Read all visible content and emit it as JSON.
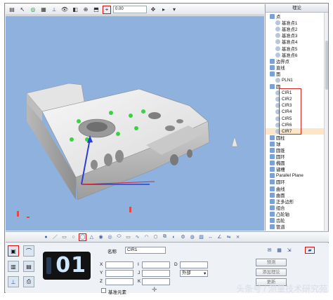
{
  "toolbar": {
    "value_field": "0.00",
    "icons": [
      "select-icon",
      "pointer-icon",
      "target-icon",
      "grid-icon",
      "axis-icon",
      "eye-icon",
      "cube-icon",
      "zoom-icon",
      "probe-icon",
      "crosshair-icon",
      "arrow-icon"
    ]
  },
  "tree": {
    "header": "理论",
    "items": [
      {
        "label": "点",
        "level": 0
      },
      {
        "label": "基准点1",
        "level": 1
      },
      {
        "label": "基准点2",
        "level": 1
      },
      {
        "label": "基准点3",
        "level": 1
      },
      {
        "label": "基准点4",
        "level": 1
      },
      {
        "label": "基准点5",
        "level": 1
      },
      {
        "label": "基准点6",
        "level": 1
      },
      {
        "label": "边界点",
        "level": 0
      },
      {
        "label": "直线",
        "level": 0
      },
      {
        "label": "面",
        "level": 0
      },
      {
        "label": "PLN1",
        "level": 1
      },
      {
        "label": "圆",
        "level": 0
      },
      {
        "label": "CIR1",
        "level": 1
      },
      {
        "label": "CIR2",
        "level": 1
      },
      {
        "label": "CIR3",
        "level": 1
      },
      {
        "label": "CIR4",
        "level": 1
      },
      {
        "label": "CIR5",
        "level": 1
      },
      {
        "label": "CIR6",
        "level": 1
      },
      {
        "label": "CIR7",
        "level": 1
      },
      {
        "label": "圆柱",
        "level": 0
      },
      {
        "label": "球",
        "level": 0
      },
      {
        "label": "圆锥",
        "level": 0
      },
      {
        "label": "圆环",
        "level": 0
      },
      {
        "label": "椭圆",
        "level": 0
      },
      {
        "label": "键槽",
        "level": 0
      },
      {
        "label": "Parallel Plane",
        "level": 0
      },
      {
        "label": "圆环",
        "level": 0
      },
      {
        "label": "曲线",
        "level": 0
      },
      {
        "label": "曲面",
        "level": 0
      },
      {
        "label": "正多边形",
        "level": 0
      },
      {
        "label": "组合",
        "level": 0
      },
      {
        "label": "凸轮轴",
        "level": 0
      },
      {
        "label": "齿轮",
        "level": 0
      },
      {
        "label": "管道",
        "level": 0
      },
      {
        "label": "CAD模型",
        "level": 0
      }
    ],
    "selected_index": 18
  },
  "feature_toolbar": {
    "icons": [
      "point-feature-icon",
      "line-feature-icon",
      "plane-feature-icon",
      "circle-feature-icon",
      "cylinder-feature-icon",
      "cone-feature-icon",
      "sphere-feature-icon",
      "torus-feature-icon",
      "ellipse-feature-icon",
      "slot-feature-icon",
      "curve-feature-icon",
      "surface-feature-icon",
      "polygon-feature-icon",
      "combo-feature-icon",
      "cam-feature-icon",
      "gear-feature-icon",
      "pipe-feature-icon",
      "cad-feature-icon",
      "distance-feature-icon",
      "angle-feature-icon",
      "symmetry-feature-icon",
      "intersect-feature-icon"
    ],
    "highlighted_index": 4
  },
  "panel": {
    "counter": "01",
    "name_label": "名称",
    "name_value": "CIR1",
    "x_label": "X",
    "y_label": "Y",
    "z_label": "Z",
    "i_label": "I",
    "j_label": "J",
    "k_label": "K",
    "d_label": "D",
    "side_value": "外部",
    "datum_label": "基准元素",
    "predict_button": "预测",
    "add_theory_button": "添加理论",
    "extra_button": "更新"
  },
  "watermark": "头条号 / 测量技术研究苑"
}
